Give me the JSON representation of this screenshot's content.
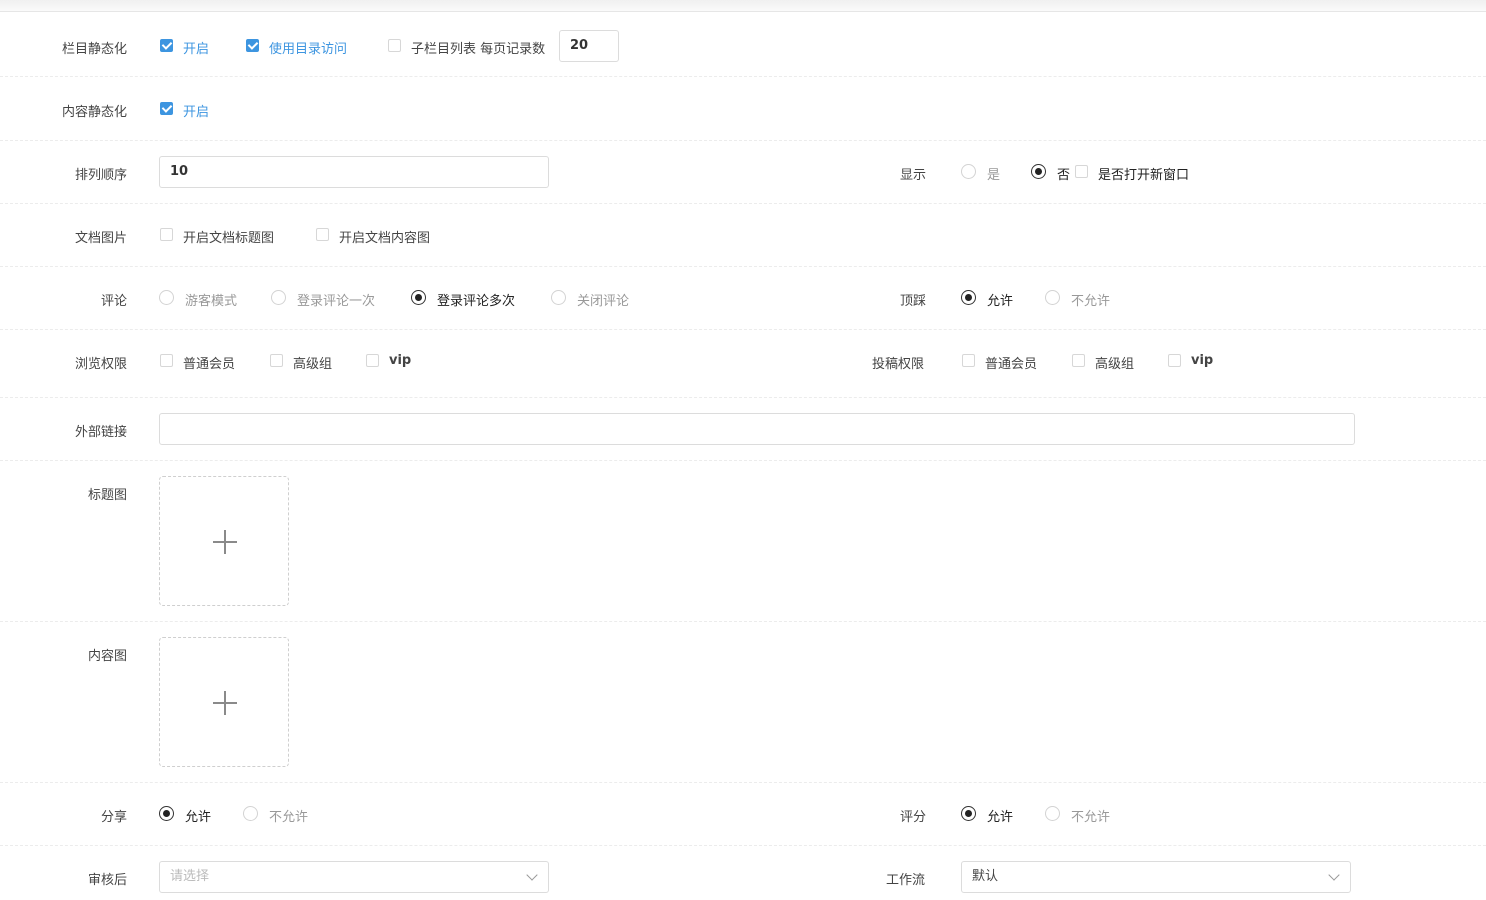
{
  "column_static": {
    "label": "栏目静态化",
    "open": {
      "label": "开启",
      "checked": true
    },
    "dir_access": {
      "label": "使用目录访问",
      "checked": true
    },
    "sub_list": {
      "label": "子栏目列表 每页记录数",
      "checked": false
    },
    "per_page": "20"
  },
  "content_static": {
    "label": "内容静态化",
    "open": {
      "label": "开启",
      "checked": true
    }
  },
  "sort_order": {
    "label": "排列顺序",
    "value": "10"
  },
  "display": {
    "label": "显示",
    "yes": "是",
    "no": "否",
    "selected": "否",
    "new_window": {
      "label": "是否打开新窗口",
      "checked": false
    }
  },
  "doc_image": {
    "label": "文档图片",
    "title_image": {
      "label": "开启文档标题图",
      "checked": false
    },
    "content_image": {
      "label": "开启文档内容图",
      "checked": false
    }
  },
  "comment": {
    "label": "评论",
    "options": [
      "游客模式",
      "登录评论一次",
      "登录评论多次",
      "关闭评论"
    ],
    "selected": "登录评论多次"
  },
  "vote": {
    "label": "顶踩",
    "options": [
      "允许",
      "不允许"
    ],
    "selected": "允许"
  },
  "browse_perm": {
    "label": "浏览权限",
    "options": [
      "普通会员",
      "高级组",
      "vip"
    ]
  },
  "submit_perm": {
    "label": "投稿权限",
    "options": [
      "普通会员",
      "高级组",
      "vip"
    ]
  },
  "external_link": {
    "label": "外部链接",
    "value": ""
  },
  "title_pic": {
    "label": "标题图"
  },
  "content_pic": {
    "label": "内容图"
  },
  "share": {
    "label": "分享",
    "options": [
      "允许",
      "不允许"
    ],
    "selected": "允许"
  },
  "rating": {
    "label": "评分",
    "options": [
      "允许",
      "不允许"
    ],
    "selected": "允许"
  },
  "after_review": {
    "label": "审核后",
    "placeholder": "请选择"
  },
  "workflow": {
    "label": "工作流",
    "value": "默认"
  },
  "colors": {
    "accent": "#3d95e0",
    "border": "#dcdcdc",
    "text": "#555555"
  },
  "icons": [
    "checkbox-checked-icon",
    "radio-icon",
    "chevron-down-icon",
    "plus-icon"
  ]
}
